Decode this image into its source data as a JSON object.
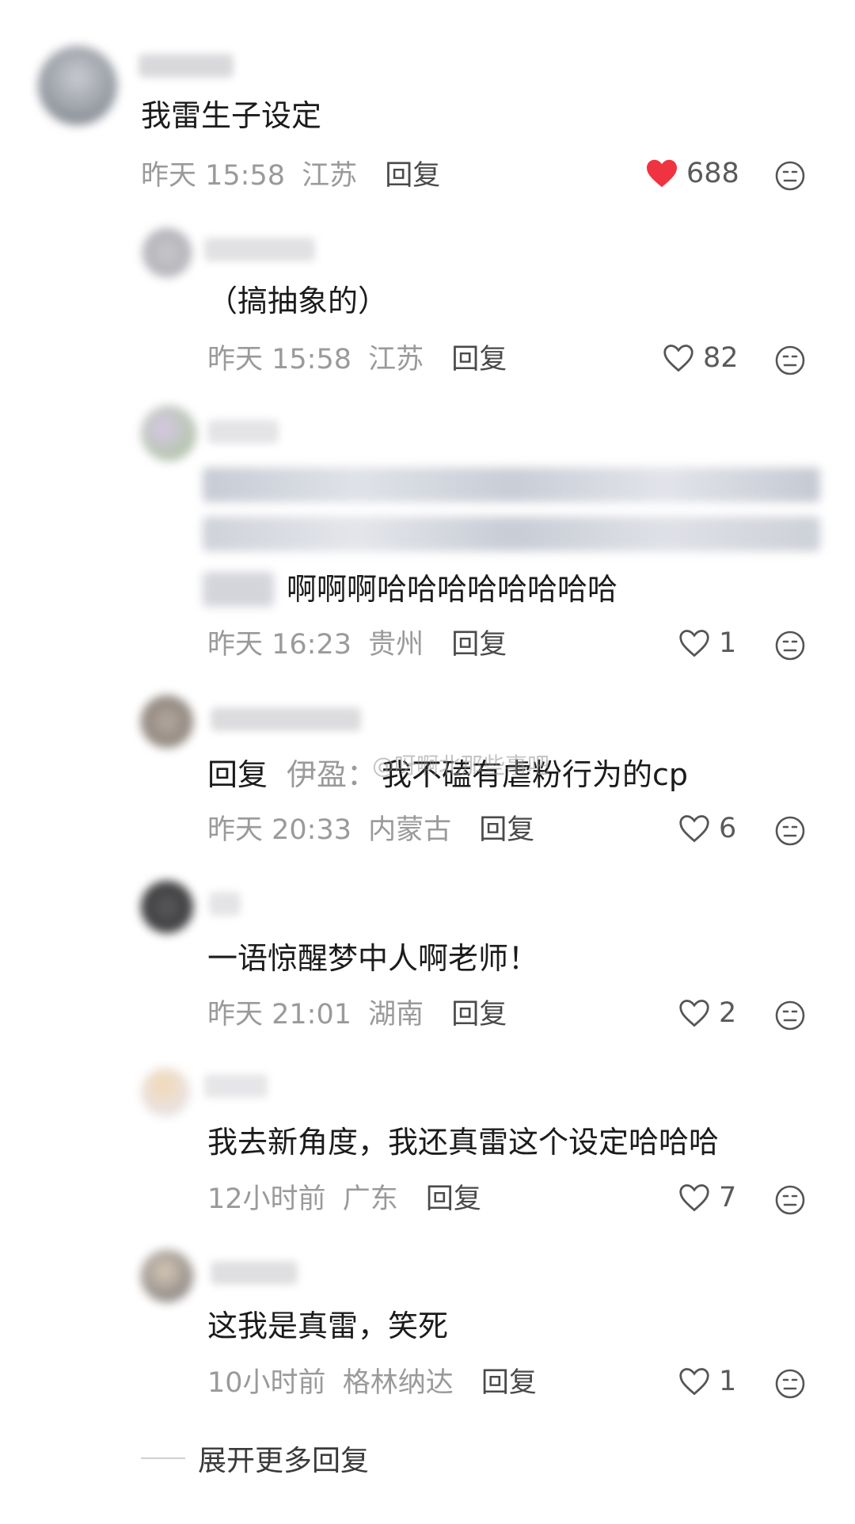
{
  "comments": [
    {
      "text": "我雷生子设定",
      "time": "昨天 15:58",
      "location": "江苏",
      "reply_label": "回复",
      "likes": "688",
      "liked": true
    },
    {
      "text": "（搞抽象的）",
      "time": "昨天 15:58",
      "location": "江苏",
      "reply_label": "回复",
      "likes": "82",
      "liked": false
    },
    {
      "text_visible": "啊啊啊哈哈哈哈哈哈哈哈",
      "time": "昨天 16:23",
      "location": "贵州",
      "reply_label": "回复",
      "likes": "1",
      "liked": false
    },
    {
      "reply_prefix": "回复",
      "reply_to": "伊盈：",
      "text": "我不磕有虐粉行为的cp",
      "time": "昨天 20:33",
      "location": "内蒙古",
      "reply_label": "回复",
      "likes": "6",
      "liked": false
    },
    {
      "text": "一语惊醒梦中人啊老师！",
      "time": "昨天 21:01",
      "location": "湖南",
      "reply_label": "回复",
      "likes": "2",
      "liked": false
    },
    {
      "text": "我去新角度，我还真雷这个设定哈哈哈",
      "time": "12小时前",
      "location": "广东",
      "reply_label": "回复",
      "likes": "7",
      "liked": false
    },
    {
      "text": "这我是真雷，笑死",
      "time": "10小时前",
      "location": "格林纳达",
      "reply_label": "回复",
      "likes": "1",
      "liked": false
    }
  ],
  "watermark": "@呀啊北那些事吧",
  "expand_more": "展开更多回复",
  "colors": {
    "liked_heart": "#f03341",
    "meta_text": "#9a9a9a",
    "primary_text": "#1b1b1b"
  }
}
